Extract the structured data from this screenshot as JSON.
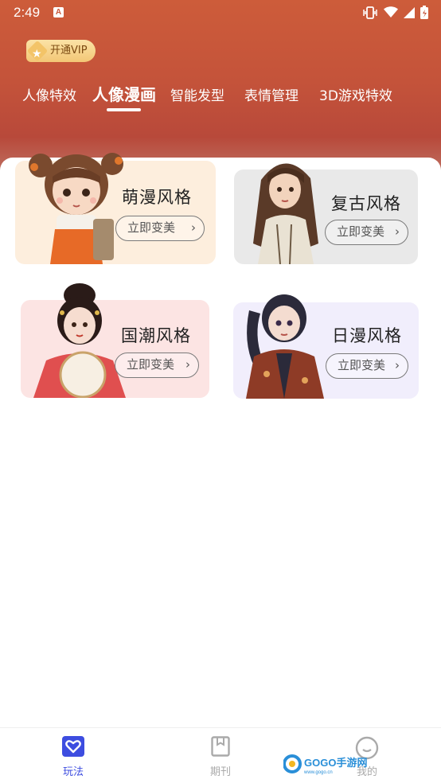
{
  "status_bar": {
    "time": "2:49",
    "notification_letter": "A"
  },
  "vip": {
    "label": "开通VIP"
  },
  "tabs": [
    {
      "label": "人像特效",
      "active": false
    },
    {
      "label": "人像漫画",
      "active": true
    },
    {
      "label": "智能发型",
      "active": false
    },
    {
      "label": "表情管理",
      "active": false
    },
    {
      "label": "3D游戏特效",
      "active": false
    }
  ],
  "cards": [
    {
      "title": "萌漫风格",
      "button": "立即变美",
      "icon": "chevron-right-icon"
    },
    {
      "title": "复古风格",
      "button": "立即变美",
      "icon": "chevron-right-icon"
    },
    {
      "title": "国潮风格",
      "button": "立即变美",
      "icon": "chevron-right-icon"
    },
    {
      "title": "日漫风格",
      "button": "立即变美",
      "icon": "chevron-right-icon"
    }
  ],
  "bottom_nav": [
    {
      "label": "玩法",
      "icon": "heart-icon",
      "active": true
    },
    {
      "label": "期刊",
      "icon": "bookmark-icon",
      "active": false
    },
    {
      "label": "我的",
      "icon": "smile-icon",
      "active": false
    }
  ],
  "watermark": {
    "text": "GOGO手游网",
    "sub": "www.gogo.cn"
  },
  "colors": {
    "header": "#c4533a",
    "accent": "#3d4de0",
    "inactive": "#aaaaaa"
  }
}
